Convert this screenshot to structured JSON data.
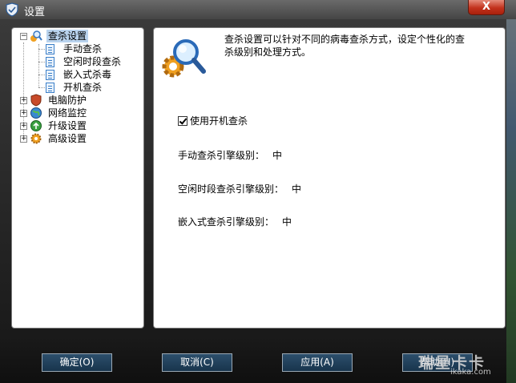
{
  "window": {
    "title": "设置",
    "close_label": "X"
  },
  "tree": {
    "root": {
      "label": "查杀设置",
      "toggle": "−",
      "children": [
        "手动查杀",
        "空闲时段查杀",
        "嵌入式杀毒",
        "开机查杀"
      ]
    },
    "others": [
      {
        "label": "电脑防护",
        "toggle": "+"
      },
      {
        "label": "网络监控",
        "toggle": "+"
      },
      {
        "label": "升级设置",
        "toggle": "+"
      },
      {
        "label": "高级设置",
        "toggle": "+"
      }
    ]
  },
  "content": {
    "description": "查杀设置可以针对不同的病毒查杀方式，设定个性化的查杀级别和处理方式。",
    "boot_scan": {
      "label": "使用开机查杀",
      "checked": true
    },
    "levels": [
      {
        "label": "手动查杀引擎级别：",
        "value": "中"
      },
      {
        "label": "空闲时段查杀引擎级别：",
        "value": "中"
      },
      {
        "label": "嵌入式查杀引擎级别：",
        "value": "中"
      }
    ]
  },
  "buttons": {
    "ok": "确定(O)",
    "cancel": "取消(C)",
    "apply": "应用(A)",
    "help": "帮助(H)"
  },
  "watermark": {
    "text": "瑞星卡卡",
    "url": "ikaka.com"
  },
  "colors": {
    "selection": "#b9d3ee",
    "button": "#1f3e58",
    "close": "#c2321c"
  }
}
